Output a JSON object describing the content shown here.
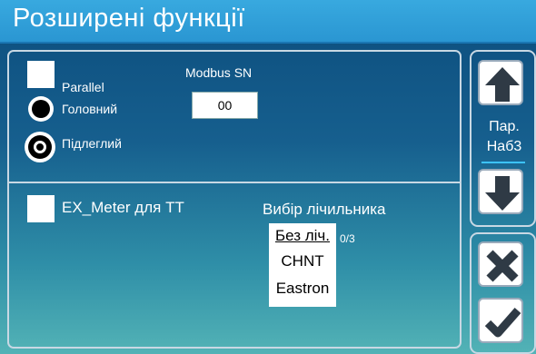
{
  "title": "Розширені функції",
  "parallel": {
    "label": "Parallel",
    "checked": false
  },
  "modbus": {
    "label": "Modbus SN",
    "value": "00"
  },
  "role": {
    "options": [
      {
        "label": "Головний",
        "selected": false
      },
      {
        "label": "Підлеглий",
        "selected": true
      }
    ]
  },
  "ex_meter": {
    "label": "EX_Meter для TT",
    "checked": false
  },
  "meter_select": {
    "label": "Вибір лічильника",
    "options": [
      "Без ліч.",
      "CHNT",
      "Eastron"
    ],
    "selected_index": 0,
    "counter": "0/3"
  },
  "paging": {
    "line1": "Пар.",
    "line2": "Наб3"
  },
  "icons": {
    "up": "up-arrow-icon",
    "down": "down-arrow-icon",
    "cancel": "close-x-icon",
    "confirm": "checkmark-icon"
  },
  "colors": {
    "title_bar": "#2a96d2",
    "background_top": "#0c4d7d",
    "background_bottom": "#53b3b6"
  }
}
